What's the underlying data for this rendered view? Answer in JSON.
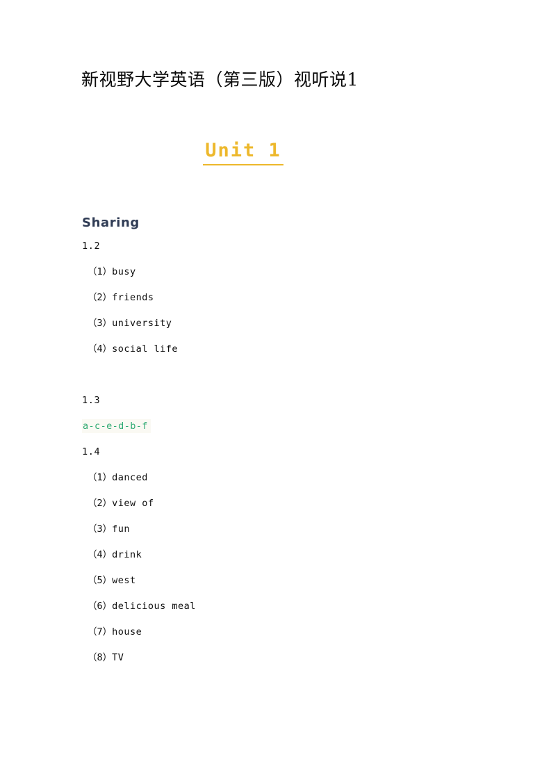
{
  "document": {
    "title": "新视野大学英语（第三版）视听说1",
    "unit_heading": "Unit 1"
  },
  "colors": {
    "unit_heading": "#edb82c",
    "section_heading": "#303c55",
    "answer_highlight_text": "#2faa73",
    "answer_highlight_bg": "#faf9f3",
    "body_text": "#0d0d0d",
    "page_background": "#ffffff"
  },
  "sections": [
    {
      "heading": "Sharing",
      "exercises": [
        {
          "number": "1.2",
          "type": "numbered-list",
          "items": [
            {
              "marker": "（1）",
              "text": "busy"
            },
            {
              "marker": "（2）",
              "text": "friends"
            },
            {
              "marker": "（3）",
              "text": "university"
            },
            {
              "marker": "（4）",
              "text": "social life"
            }
          ]
        },
        {
          "number": "1.3",
          "type": "sequence",
          "answer": "a-c-e-d-b-f"
        },
        {
          "number": "1.4",
          "type": "numbered-list",
          "items": [
            {
              "marker": "（1）",
              "text": "danced"
            },
            {
              "marker": "（2）",
              "text": "view of"
            },
            {
              "marker": "（3）",
              "text": "fun"
            },
            {
              "marker": "（4）",
              "text": "drink"
            },
            {
              "marker": "（5）",
              "text": "west"
            },
            {
              "marker": "（6）",
              "text": "delicious meal"
            },
            {
              "marker": "（7）",
              "text": "house"
            },
            {
              "marker": "（8）",
              "text": "TV"
            }
          ]
        }
      ]
    }
  ]
}
